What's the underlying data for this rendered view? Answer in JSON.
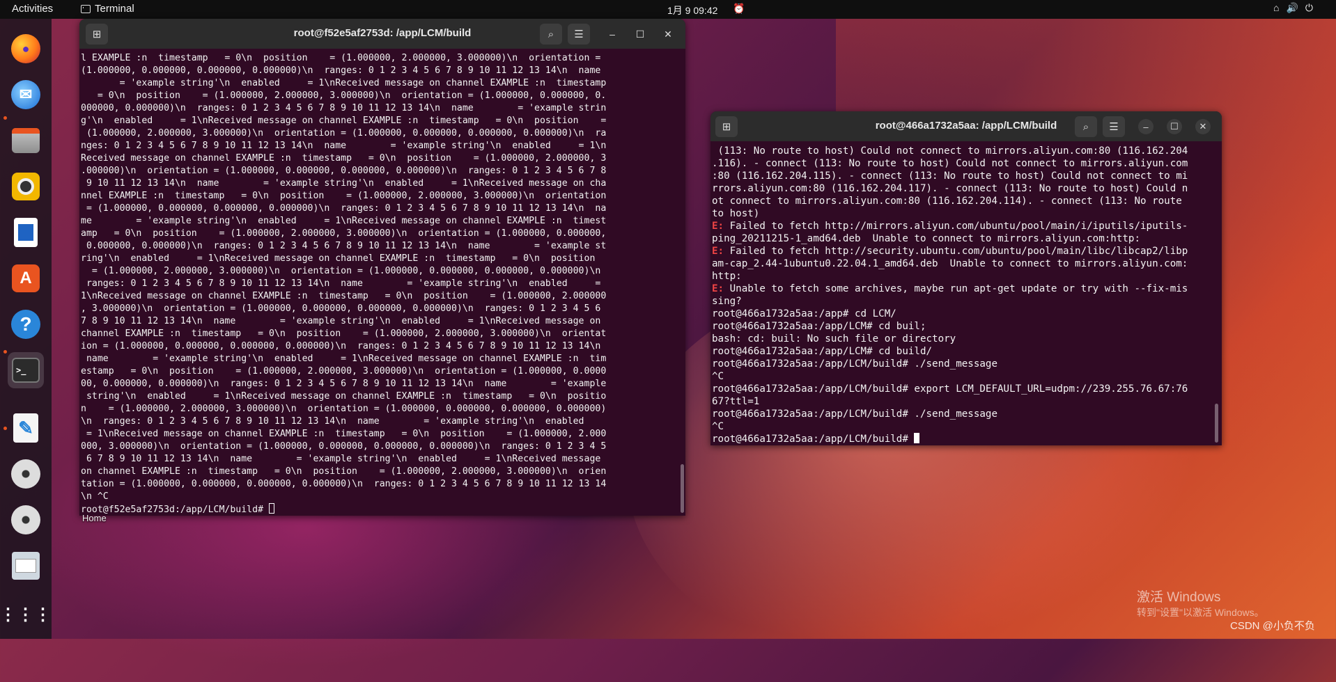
{
  "topbar": {
    "activities": "Activities",
    "app_name": "Terminal",
    "clock": "1月 9  09:42"
  },
  "dock": {
    "items": [
      {
        "name": "Firefox",
        "icon": "firefox-icon"
      },
      {
        "name": "Thunderbird",
        "icon": "thunderbird-icon"
      },
      {
        "name": "Files",
        "icon": "files-icon"
      },
      {
        "name": "Rhythmbox",
        "icon": "rhythmbox-icon"
      },
      {
        "name": "LibreOffice Writer",
        "icon": "writer-icon"
      },
      {
        "name": "Ubuntu Software",
        "icon": "software-icon"
      },
      {
        "name": "Help",
        "icon": "help-icon"
      },
      {
        "name": "Terminal",
        "icon": "terminal-icon"
      },
      {
        "name": "Text Editor",
        "icon": "text-editor-icon"
      },
      {
        "name": "Disc",
        "icon": "disc-icon"
      },
      {
        "name": "Disc",
        "icon": "disc-icon"
      },
      {
        "name": "Save",
        "icon": "floppy-icon"
      },
      {
        "name": "Show Applications",
        "icon": "app-grid-icon"
      }
    ]
  },
  "window1": {
    "title": "root@f52e5af2753d: /app/LCM/build",
    "lines": [
      "l EXAMPLE :n  timestamp   = 0\\n  position    = (1.000000, 2.000000, 3.000000)\\n  orientation =",
      "(1.000000, 0.000000, 0.000000, 0.000000)\\n  ranges: 0 1 2 3 4 5 6 7 8 9 10 11 12 13 14\\n  name",
      "       = 'example string'\\n  enabled     = 1\\nReceived message on channel EXAMPLE :n  timestamp",
      "   = 0\\n  position    = (1.000000, 2.000000, 3.000000)\\n  orientation = (1.000000, 0.000000, 0.",
      "000000, 0.000000)\\n  ranges: 0 1 2 3 4 5 6 7 8 9 10 11 12 13 14\\n  name        = 'example strin",
      "g'\\n  enabled     = 1\\nReceived message on channel EXAMPLE :n  timestamp   = 0\\n  position    =",
      " (1.000000, 2.000000, 3.000000)\\n  orientation = (1.000000, 0.000000, 0.000000, 0.000000)\\n  ra",
      "nges: 0 1 2 3 4 5 6 7 8 9 10 11 12 13 14\\n  name        = 'example string'\\n  enabled     = 1\\n",
      "Received message on channel EXAMPLE :n  timestamp   = 0\\n  position    = (1.000000, 2.000000, 3",
      ".000000)\\n  orientation = (1.000000, 0.000000, 0.000000, 0.000000)\\n  ranges: 0 1 2 3 4 5 6 7 8",
      " 9 10 11 12 13 14\\n  name        = 'example string'\\n  enabled     = 1\\nReceived message on cha",
      "nnel EXAMPLE :n  timestamp   = 0\\n  position    = (1.000000, 2.000000, 3.000000)\\n  orientation",
      " = (1.000000, 0.000000, 0.000000, 0.000000)\\n  ranges: 0 1 2 3 4 5 6 7 8 9 10 11 12 13 14\\n  na",
      "me        = 'example string'\\n  enabled     = 1\\nReceived message on channel EXAMPLE :n  timest",
      "amp   = 0\\n  position    = (1.000000, 2.000000, 3.000000)\\n  orientation = (1.000000, 0.000000,",
      " 0.000000, 0.000000)\\n  ranges: 0 1 2 3 4 5 6 7 8 9 10 11 12 13 14\\n  name        = 'example st",
      "ring'\\n  enabled     = 1\\nReceived message on channel EXAMPLE :n  timestamp   = 0\\n  position",
      "  = (1.000000, 2.000000, 3.000000)\\n  orientation = (1.000000, 0.000000, 0.000000, 0.000000)\\n",
      " ranges: 0 1 2 3 4 5 6 7 8 9 10 11 12 13 14\\n  name        = 'example string'\\n  enabled     =",
      "1\\nReceived message on channel EXAMPLE :n  timestamp   = 0\\n  position    = (1.000000, 2.000000",
      ", 3.000000)\\n  orientation = (1.000000, 0.000000, 0.000000, 0.000000)\\n  ranges: 0 1 2 3 4 5 6",
      "7 8 9 10 11 12 13 14\\n  name        = 'example string'\\n  enabled     = 1\\nReceived message on",
      "channel EXAMPLE :n  timestamp   = 0\\n  position    = (1.000000, 2.000000, 3.000000)\\n  orientat",
      "ion = (1.000000, 0.000000, 0.000000, 0.000000)\\n  ranges: 0 1 2 3 4 5 6 7 8 9 10 11 12 13 14\\n",
      " name        = 'example string'\\n  enabled     = 1\\nReceived message on channel EXAMPLE :n  tim",
      "estamp   = 0\\n  position    = (1.000000, 2.000000, 3.000000)\\n  orientation = (1.000000, 0.0000",
      "00, 0.000000, 0.000000)\\n  ranges: 0 1 2 3 4 5 6 7 8 9 10 11 12 13 14\\n  name        = 'example",
      " string'\\n  enabled     = 1\\nReceived message on channel EXAMPLE :n  timestamp   = 0\\n  positio",
      "n    = (1.000000, 2.000000, 3.000000)\\n  orientation = (1.000000, 0.000000, 0.000000, 0.000000)",
      "\\n  ranges: 0 1 2 3 4 5 6 7 8 9 10 11 12 13 14\\n  name        = 'example string'\\n  enabled",
      " = 1\\nReceived message on channel EXAMPLE :n  timestamp   = 0\\n  position    = (1.000000, 2.000",
      "000, 3.000000)\\n  orientation = (1.000000, 0.000000, 0.000000, 0.000000)\\n  ranges: 0 1 2 3 4 5",
      " 6 7 8 9 10 11 12 13 14\\n  name        = 'example string'\\n  enabled     = 1\\nReceived message",
      "on channel EXAMPLE :n  timestamp   = 0\\n  position    = (1.000000, 2.000000, 3.000000)\\n  orien",
      "tation = (1.000000, 0.000000, 0.000000, 0.000000)\\n  ranges: 0 1 2 3 4 5 6 7 8 9 10 11 12 13 14",
      "\\n ^C"
    ],
    "prompt": "root@f52e5af2753d:/app/LCM/build# "
  },
  "window2": {
    "title": "root@466a1732a5aa: /app/LCM/build",
    "lines": [
      {
        "text": " (113: No route to host) Could not connect to mirrors.aliyun.com:80 (116.162.204"
      },
      {
        "text": ".116). - connect (113: No route to host) Could not connect to mirrors.aliyun.com"
      },
      {
        "text": ":80 (116.162.204.115). - connect (113: No route to host) Could not connect to mi"
      },
      {
        "text": "rrors.aliyun.com:80 (116.162.204.117). - connect (113: No route to host) Could n"
      },
      {
        "text": "ot connect to mirrors.aliyun.com:80 (116.162.204.114). - connect (113: No route"
      },
      {
        "text": "to host)"
      },
      {
        "prefix": "E:",
        "text": " Failed to fetch http://mirrors.aliyun.com/ubuntu/pool/main/i/iputils/iputils-"
      },
      {
        "text": "ping_20211215-1_amd64.deb  Unable to connect to mirrors.aliyun.com:http:"
      },
      {
        "prefix": "E:",
        "text": " Failed to fetch http://security.ubuntu.com/ubuntu/pool/main/libc/libcap2/libp"
      },
      {
        "text": "am-cap_2.44-1ubuntu0.22.04.1_amd64.deb  Unable to connect to mirrors.aliyun.com:"
      },
      {
        "text": "http:"
      },
      {
        "prefix": "E:",
        "text": " Unable to fetch some archives, maybe run apt-get update or try with --fix-mis"
      },
      {
        "text": "sing?"
      },
      {
        "text": "root@466a1732a5aa:/app# cd LCM/"
      },
      {
        "text": "root@466a1732a5aa:/app/LCM# cd buil;"
      },
      {
        "text": "bash: cd: buil: No such file or directory"
      },
      {
        "text": "root@466a1732a5aa:/app/LCM# cd build/"
      },
      {
        "text": "root@466a1732a5aa:/app/LCM/build# ./send_message"
      },
      {
        "text": "^C"
      },
      {
        "text": "root@466a1732a5aa:/app/LCM/build# export LCM_DEFAULT_URL=udpm://239.255.76.67:76"
      },
      {
        "text": "67?ttl=1"
      },
      {
        "text": "root@466a1732a5aa:/app/LCM/build# ./send_message"
      },
      {
        "text": "^C"
      }
    ],
    "prompt": "root@466a1732a5aa:/app/LCM/build# "
  },
  "desktop": {
    "home_label": "Home",
    "watermark_line1": "激活 Windows",
    "watermark_line2": "转到\"设置\"以激活 Windows。",
    "csdn": "CSDN @小负不负"
  }
}
